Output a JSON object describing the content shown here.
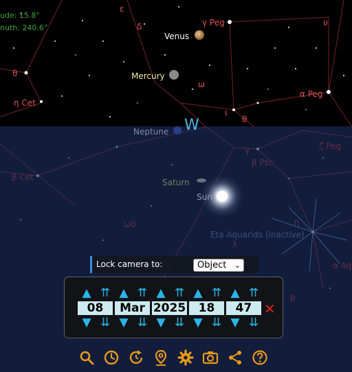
{
  "hud": {
    "altitude": "ude: 15.8°",
    "azimuth": "nuth: 240.6°"
  },
  "sky_labels": {
    "venus": "Venus",
    "mercury": "Mercury",
    "neptune": "Neptune",
    "saturn": "Saturn",
    "sun": "Sun",
    "west": "W",
    "gamma_peg": "γ Peg",
    "alpha_peg": "α Peg",
    "zeta_peg": "ζ Peg",
    "beta_psc": "β Psc",
    "eta_cet": "η Cet",
    "beta_cet": "β Cet",
    "eta_aquariids": "Eta Aquarids (inactive)",
    "omega0": "ω0",
    "alpha_aq": "α Aq",
    "theta_left": "θ",
    "theta_mid": "θ",
    "theta_low": "θ",
    "epsilon": "ε",
    "delta": "δ",
    "omega": "ω",
    "iota": "ι",
    "upsilon": "υ",
    "gamma_low": "γ",
    "eta_low": "η",
    "lambda": "λ"
  },
  "lock_camera": {
    "label": "Lock camera to:",
    "selected": "Object"
  },
  "date_time": {
    "day": "08",
    "month": "Mar",
    "year": "2025",
    "hour": "18",
    "minute": "47",
    "up_single": "▲",
    "up_double": "⇈",
    "down_single": "▼",
    "down_double": "⇊",
    "close": "✕"
  },
  "colors": {
    "accent": "#2bb4e8",
    "field_bg": "#cdeaf0",
    "close": "#e02020",
    "constellation_line": "#8a2a30"
  },
  "toolbar": [
    "search-icon",
    "clock-icon",
    "refresh-time-icon",
    "location-pin-icon",
    "gear-icon",
    "camera-icon",
    "share-icon",
    "help-icon"
  ]
}
